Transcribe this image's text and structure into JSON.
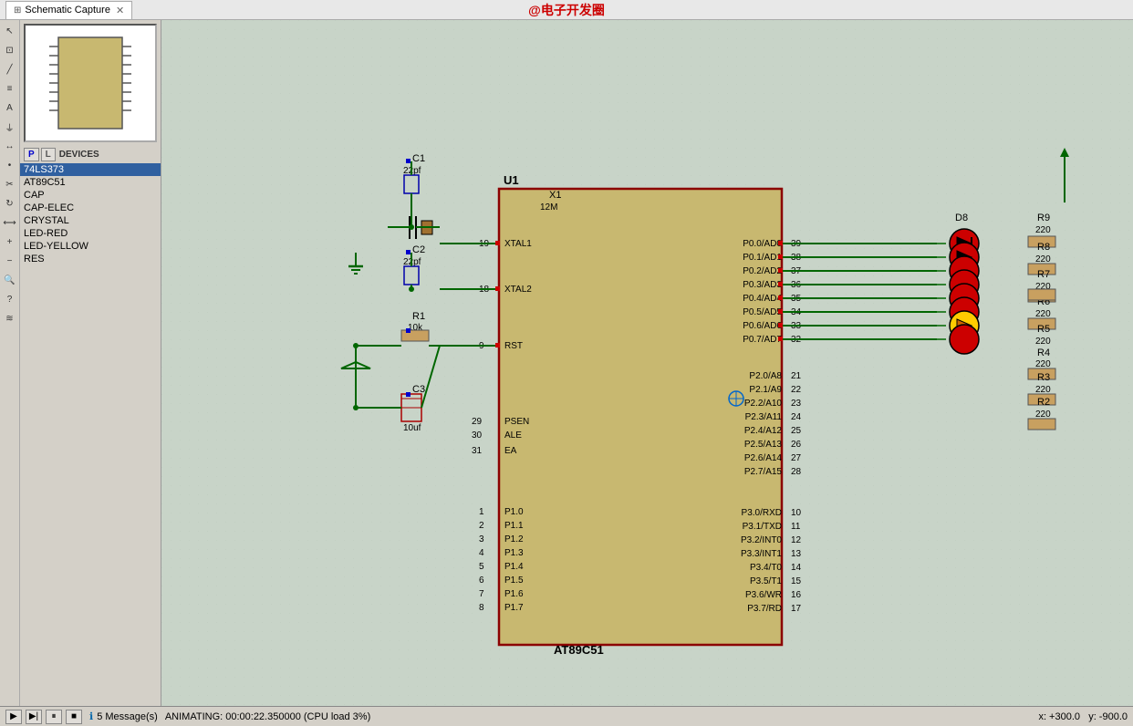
{
  "titlebar": {
    "tab_label": "Schematic Capture",
    "page_title": "@电子开发圈"
  },
  "devices": {
    "p_label": "P",
    "l_label": "L",
    "devices_label": "DEVICES",
    "items": [
      {
        "id": "74ls373",
        "label": "74LS373",
        "selected": true
      },
      {
        "id": "at89c51",
        "label": "AT89C51",
        "selected": false
      },
      {
        "id": "cap",
        "label": "CAP",
        "selected": false
      },
      {
        "id": "cap-elec",
        "label": "CAP-ELEC",
        "selected": false
      },
      {
        "id": "crystal",
        "label": "CRYSTAL",
        "selected": false
      },
      {
        "id": "led-red",
        "label": "LED-RED",
        "selected": false
      },
      {
        "id": "led-yellow",
        "label": "LED-YELLOW",
        "selected": false
      },
      {
        "id": "res",
        "label": "RES",
        "selected": false
      }
    ]
  },
  "statusbar": {
    "messages": "5 Message(s)",
    "animation": "ANIMATING: 00:00:22.350000 (CPU load 3%)",
    "x_coord": "x:   +300.0",
    "y_coord": "y:    -900.0"
  },
  "schematic": {
    "ic_label": "U1",
    "ic_name": "AT89C51",
    "crystal_label": "X1",
    "crystal_val": "12M",
    "c1_label": "C1",
    "c1_val": "22pf",
    "c2_label": "C2",
    "c2_val": "22pf",
    "c3_label": "C3",
    "c3_val": "10uf",
    "r1_label": "R1",
    "r1_val": "10k",
    "resistors": [
      {
        "label": "R2",
        "val": "220"
      },
      {
        "label": "R3",
        "val": "220"
      },
      {
        "label": "R4",
        "val": "220"
      },
      {
        "label": "R5",
        "val": "220"
      },
      {
        "label": "R6",
        "val": "220"
      },
      {
        "label": "R7",
        "val": "220"
      },
      {
        "label": "R8",
        "val": "220"
      },
      {
        "label": "R9",
        "val": "220"
      }
    ],
    "led_label": "D8"
  }
}
